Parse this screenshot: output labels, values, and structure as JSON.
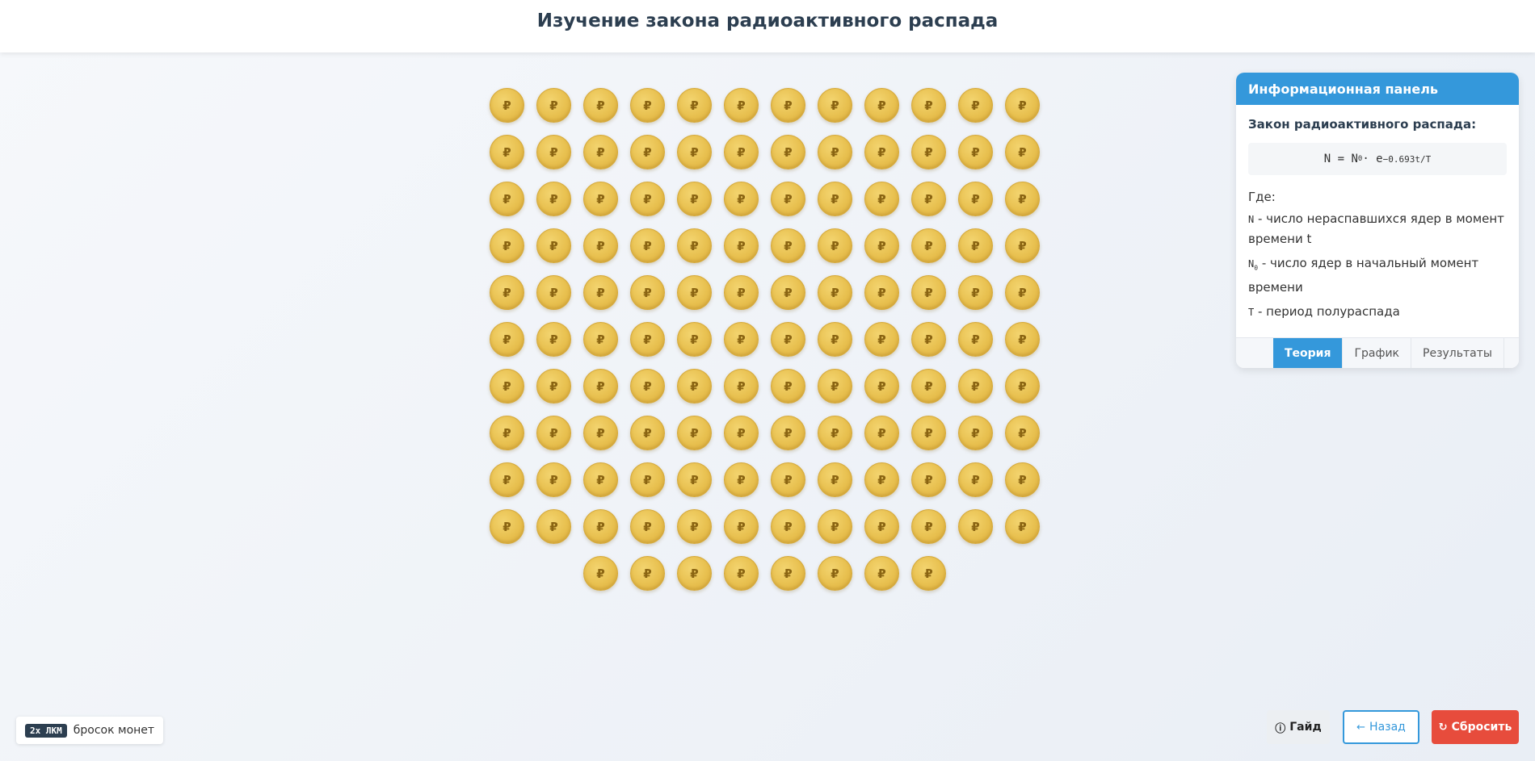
{
  "header": {
    "title": "Изучение закона радиоактивного распада"
  },
  "coins": {
    "symbol": "₽",
    "count": 128,
    "rows": [
      12,
      12,
      12,
      12,
      12,
      12,
      12,
      12,
      12,
      12,
      8
    ],
    "color": "#e8c04f"
  },
  "panel": {
    "title": "Информационная панель",
    "law_title": "Закон радиоактивного распада:",
    "formula": {
      "lhs": "N = N",
      "sub": "0",
      "mid": " · e",
      "exp": "−0.693t/T"
    },
    "where": "Где:",
    "defs": [
      {
        "sym": "N",
        "sub": "",
        "text": " - число нераспавшихся ядер в момент времени t"
      },
      {
        "sym": "N",
        "sub": "0",
        "text": " - число ядер в начальный момент времени"
      },
      {
        "sym": "T",
        "sub": "",
        "text": " - период полураспада"
      }
    ],
    "tabs": [
      "Теория",
      "График",
      "Результаты"
    ],
    "active_tab": "Теория",
    "accent": "#3498db"
  },
  "hint": {
    "key": "2x ЛКМ",
    "text": "бросок монет"
  },
  "buttons": {
    "guide": "Гайд",
    "back": "Назад",
    "reset": "Сбросить",
    "reset_color": "#e74c3c"
  }
}
